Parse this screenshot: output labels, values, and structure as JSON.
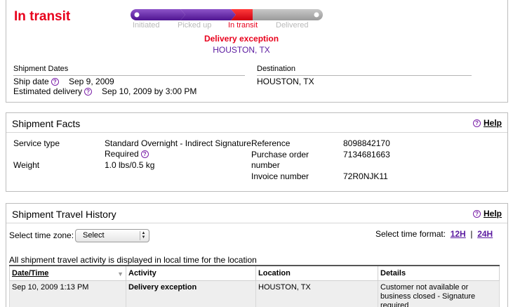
{
  "summary": {
    "status": "In transit",
    "steps": [
      "Initiated",
      "Picked up",
      "In transit",
      "Delivered"
    ],
    "exception_title": "Delivery exception",
    "exception_location": "HOUSTON, TX",
    "shipment_dates_label": "Shipment Dates",
    "destination_label": "Destination",
    "ship_date_label": "Ship date",
    "ship_date": "Sep 9, 2009",
    "est_delivery_label": "Estimated delivery",
    "est_delivery": "Sep 10, 2009 by 3:00 PM",
    "destination": "HOUSTON, TX"
  },
  "facts": {
    "title": "Shipment Facts",
    "help": "Help",
    "service_type_label": "Service type",
    "service_type_line1": "Standard Overnight - Indirect Signature",
    "service_type_line2": "Required",
    "weight_label": "Weight",
    "weight": "1.0 lbs/0.5 kg",
    "reference_label": "Reference",
    "reference": "8098842170",
    "po_label_line1": "Purchase order",
    "po_label_line2": "number",
    "po": "7134681663",
    "invoice_label": "Invoice number",
    "invoice": "72R0NJK11"
  },
  "history": {
    "title": "Shipment Travel History",
    "help": "Help",
    "timezone_label": "Select time zone:",
    "timezone_value": "Select",
    "format_label": "Select time format:",
    "format_12h": "12H",
    "format_sep": "|",
    "format_24h": "24H",
    "note": "All shipment travel activity is displayed in local time for the location",
    "columns": [
      "Date/Time",
      "Activity",
      "Location",
      "Details"
    ],
    "rows": [
      {
        "datetime": "Sep 10, 2009 1:13 PM",
        "activity": "Delivery exception",
        "location": "HOUSTON, TX",
        "details": "Customer not available or business closed - Signature required"
      }
    ]
  },
  "colors": {
    "status_red": "#e8001c",
    "fedex_purple": "#5a1aa0",
    "progress_gray": "#a8a8a8"
  }
}
